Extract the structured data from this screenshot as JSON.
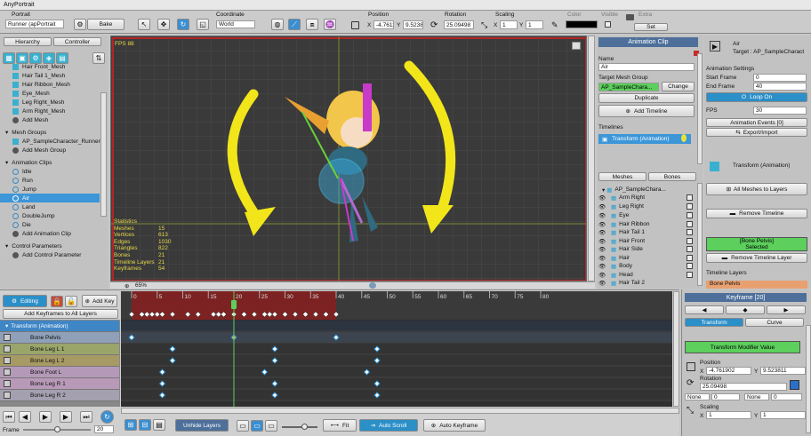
{
  "window": {
    "title": "AnyPortrait"
  },
  "toolbar": {
    "portrait_label": "Portrait",
    "portrait_value": "Runner (apPortrait",
    "bake_label": "Bake",
    "coordinate_label": "Coordinate",
    "coordinate_value": "World",
    "position_label": "Position",
    "position_x": "-4.7611",
    "position_y": "9.5238",
    "rotation_label": "Rotation",
    "rotation_value": "25.09498",
    "scaling_label": "Scaling",
    "scaling_x": "1",
    "scaling_y": "1",
    "color_label": "Color",
    "visible_label": "Visible",
    "extra_label": "Extra",
    "set_label": "Set",
    "x_label": "X",
    "y_label": "Y"
  },
  "left_panel": {
    "tabs": [
      "Hierarchy",
      "Controller"
    ],
    "mesh_items": [
      "Hair Front_Mesh",
      "Hair Tail 1_Mesh",
      "Hair Ribbon_Mesh",
      "Eye_Mesh",
      "Leg Right_Mesh",
      "Arm Right_Mesh",
      "Add Mesh"
    ],
    "mesh_groups_header": "Mesh Groups",
    "mesh_group_items": [
      "AP_SampleCharacter_Runner",
      "Add Mesh Group"
    ],
    "animation_clips_header": "Animation Clips",
    "animation_clip_items": [
      "Idle",
      "Run",
      "Jump",
      "Air",
      "Land",
      "DoubleJump",
      "Die",
      "Add Animation Clip"
    ],
    "control_params_header": "Control Parameters",
    "control_param_items": [
      "Add Control Parameter"
    ]
  },
  "viewport": {
    "fps": "FPS 88",
    "zoom": "65%",
    "stats_title": "Statistics",
    "stats": [
      {
        "label": "Meshes",
        "value": "15"
      },
      {
        "label": "Vertices",
        "value": "613"
      },
      {
        "label": "Edges",
        "value": "1030"
      },
      {
        "label": "Triangles",
        "value": "822"
      },
      {
        "label": "Bones",
        "value": "21"
      },
      {
        "label": "Timeline Layers",
        "value": "21"
      },
      {
        "label": "Keyframes",
        "value": "54"
      }
    ]
  },
  "anim_clip_panel": {
    "header": "Animation Clip",
    "name_label": "Name",
    "name_value": "Air",
    "target_label": "Target Mesh Group",
    "target_value": "AP_SampleChara...",
    "change_label": "Change",
    "duplicate_label": "Duplicate",
    "add_timeline_label": "Add Timeline",
    "timelines_label": "Timelines",
    "timeline_item": "Transform (Animation)",
    "tabs": [
      "Meshes",
      "Bones"
    ],
    "mesh_root": "AP_SampleChara...",
    "mesh_list": [
      "Arm Right",
      "Leg Right",
      "Eye",
      "Hair Ribbon",
      "Hair Tail 1",
      "Hair Front",
      "Hair Side",
      "Hair",
      "Body",
      "Head",
      "Hair Tail 2"
    ]
  },
  "right_panel": {
    "clip_name": "Air",
    "target": "Target : AP_SampleCharact",
    "settings_label": "Animation Settings",
    "start_frame_label": "Start Frame",
    "start_frame": "0",
    "end_frame_label": "End Frame",
    "end_frame": "40",
    "loop_label": "Loop On",
    "fps_label": "FPS",
    "fps_value": "30",
    "events_label": "Animation Events [0]",
    "export_label": "Export/Import",
    "transform_label": "Transform (Animation)",
    "all_meshes_label": "All Meshes to Layers",
    "remove_timeline_label": "Remove Timeline",
    "bone_selected": "[Bone Pelvis]\nSelected",
    "remove_layer_label": "Remove Timeline Layer",
    "timeline_layers_label": "Timeline Layers",
    "layer_item": "Bone Pelvis"
  },
  "timeline": {
    "editing_label": "Editing",
    "add_key_label": "Add Key",
    "add_keyframes_label": "Add Keyframes to All Layers",
    "ruler_ticks": [
      "0",
      "5",
      "10",
      "15",
      "20",
      "25",
      "30",
      "35",
      "40",
      "45",
      "50",
      "55",
      "60",
      "65",
      "70",
      "75",
      "80"
    ],
    "tracks": [
      {
        "name": "Transform (Animation)",
        "color": "#3f86c6"
      },
      {
        "name": "Bone Pelvis",
        "color": "#8fa0b8"
      },
      {
        "name": "Bone Leg L 1",
        "color": "#9aa56a"
      },
      {
        "name": "Bone Leg L 2",
        "color": "#a89a64"
      },
      {
        "name": "Bone Foot L",
        "color": "#b49ab8"
      },
      {
        "name": "Bone Leg R 1",
        "color": "#b89ab8"
      },
      {
        "name": "Bone Leg R 2",
        "color": "#a4a0b0"
      }
    ],
    "frame_label": "Frame",
    "frame_value": "20",
    "unhide_layers_label": "Unhide Layers",
    "fit_label": "Fit",
    "auto_scroll_label": "Auto Scroll",
    "auto_keyframe_label": "Auto Keyframe",
    "current_frame": 20,
    "loop_end": 40
  },
  "keyframe_panel": {
    "header": "Keyframe [20]",
    "tab_transform": "Transform",
    "tab_curve": "Curve",
    "modifier_label": "Transform Modifier Value",
    "position_label": "Position",
    "position_x": "-4.761902",
    "position_y": "9.523811",
    "rotation_label": "Rotation",
    "rotation_value": "25.09498",
    "none_label_1": "None",
    "none_value_1": "0",
    "none_label_2": "None",
    "none_value_2": "0",
    "scaling_label": "Scaling",
    "scaling_x": "1",
    "scaling_y": "1"
  },
  "colors": {
    "accent": "#3c96d8",
    "green": "#5ccf5c",
    "stats": "#e6d84a",
    "loop_region": "#8a1f1f"
  }
}
